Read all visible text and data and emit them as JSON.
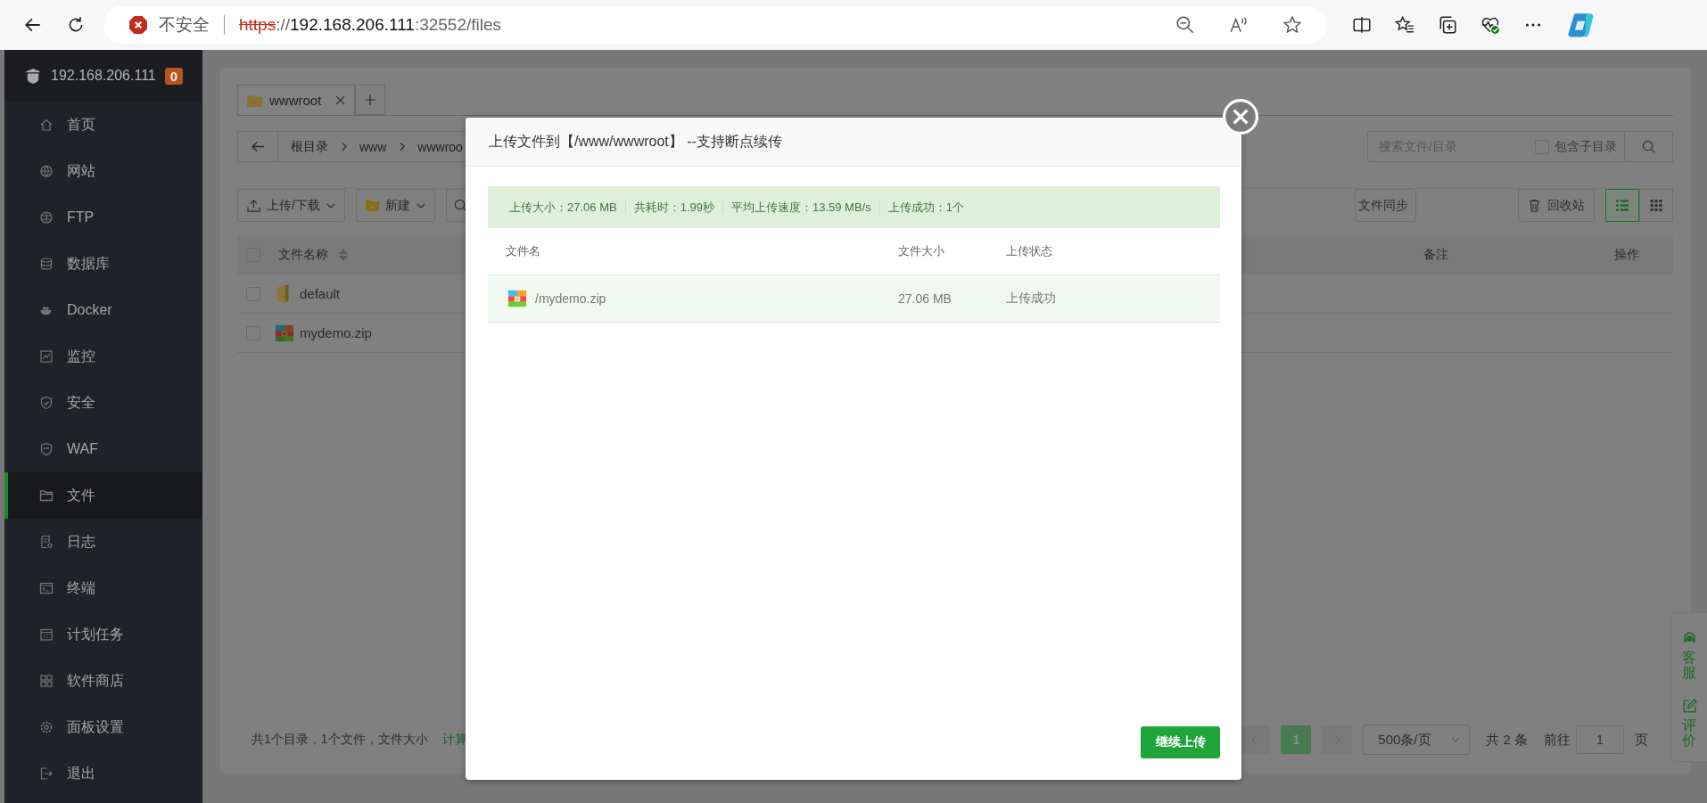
{
  "browser": {
    "security": "不安全",
    "url_parts": [
      {
        "text": "https",
        "kind": "insecure"
      },
      {
        "text": "://",
        "kind": "dim"
      },
      {
        "text": "192.168.206.111",
        "kind": "host"
      },
      {
        "text": ":32552/files",
        "kind": "dim"
      }
    ]
  },
  "sidebar": {
    "host": "192.168.206.111",
    "badge": "0",
    "items": [
      {
        "label": "首页",
        "selected": false
      },
      {
        "label": "网站",
        "selected": false
      },
      {
        "label": "FTP",
        "selected": false
      },
      {
        "label": "数据库",
        "selected": false
      },
      {
        "label": "Docker",
        "selected": false
      },
      {
        "label": "监控",
        "selected": false
      },
      {
        "label": "安全",
        "selected": false
      },
      {
        "label": "WAF",
        "selected": false
      },
      {
        "label": "文件",
        "selected": true
      },
      {
        "label": "日志",
        "selected": false
      },
      {
        "label": "终端",
        "selected": false
      },
      {
        "label": "计划任务",
        "selected": false
      },
      {
        "label": "软件商店",
        "selected": false
      },
      {
        "label": "面板设置",
        "selected": false
      },
      {
        "label": "退出",
        "selected": false
      }
    ]
  },
  "tabs": [
    {
      "label": "wwwroot"
    }
  ],
  "breadcrumb": [
    "根目录",
    "www",
    "wwwroo"
  ],
  "search": {
    "placeholder": "搜索文件/目录",
    "include_subdirs": {
      "label": "包含子目录",
      "checked": false
    }
  },
  "toolbar": {
    "left": [
      {
        "label": "上传/下载",
        "kind": "upload"
      },
      {
        "label": "新建",
        "kind": "new"
      }
    ],
    "sync": "文件同步",
    "trash": "回收站",
    "views": [
      {
        "kind": "list",
        "selected": true
      },
      {
        "kind": "grid",
        "selected": false
      }
    ]
  },
  "table": {
    "select_all": false,
    "columns": [
      "文件名称",
      "备注",
      "操作"
    ],
    "rows": [
      {
        "name": "default",
        "kind": "folder",
        "checked": false
      },
      {
        "name": "mydemo.zip",
        "kind": "zip",
        "checked": false
      }
    ]
  },
  "footer": {
    "summary": "共1个目录，1个文件，文件大小",
    "link": "计算"
  },
  "pagination": {
    "pages": [
      {
        "label": "1",
        "selected": true
      }
    ],
    "page_size": "500条/页",
    "total": "共 2 条",
    "goto": "前往",
    "goto_value": "1",
    "goto_unit": "页"
  },
  "help": [
    "客服",
    "评价"
  ],
  "dialog": {
    "title": "上传文件到【/www/wwwroot】 --支持断点续传",
    "stats": [
      "上传大小：27.06 MB",
      "共耗时：1.99秒",
      "平均上传速度：13.59 MB/s",
      "上传成功：1个"
    ],
    "columns": [
      "文件名",
      "文件大小",
      "上传状态"
    ],
    "rows": [
      {
        "name": "/mydemo.zip",
        "size": "27.06 MB",
        "status": "上传成功"
      }
    ],
    "button": "继续上传"
  }
}
